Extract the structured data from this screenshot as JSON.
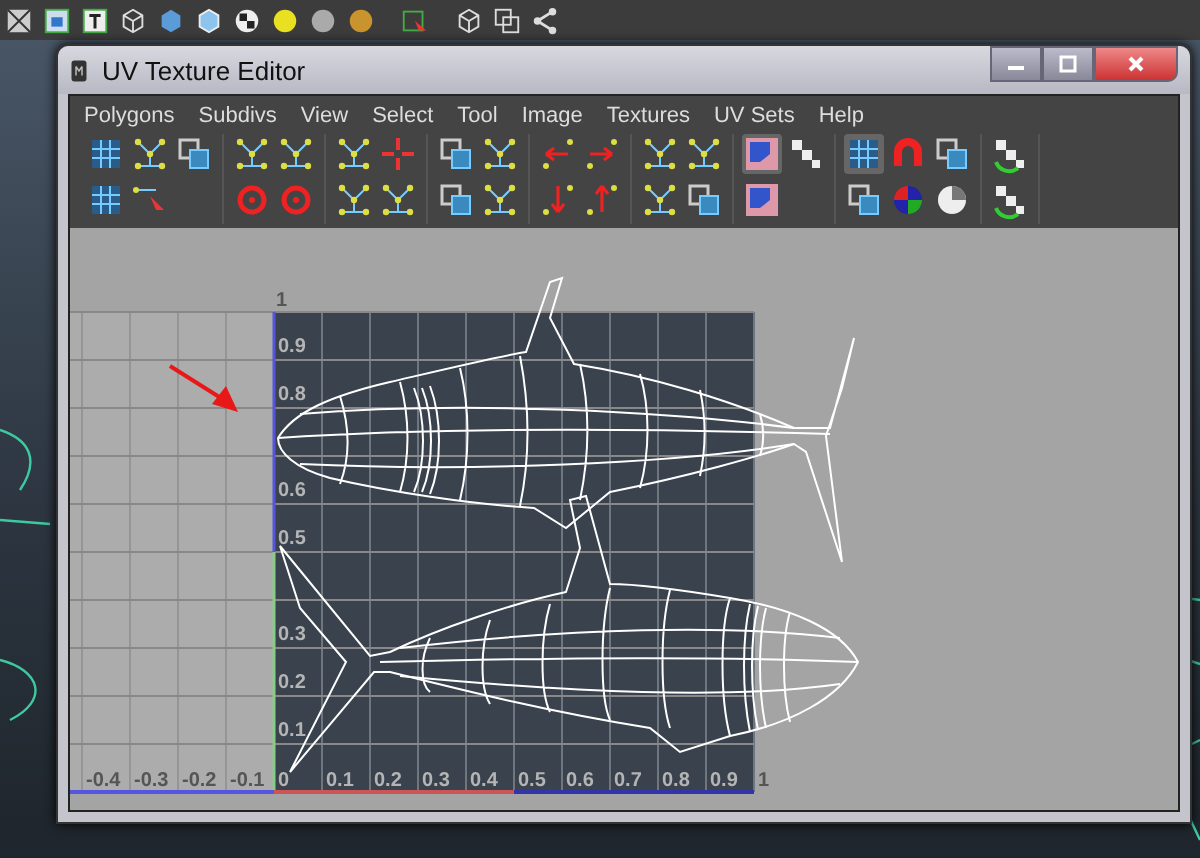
{
  "window": {
    "title": "UV Texture Editor"
  },
  "menu": [
    "Polygons",
    "Subdivs",
    "View",
    "Select",
    "Tool",
    "Image",
    "Textures",
    "UV Sets",
    "Help"
  ],
  "uv_grid": {
    "top_label": "1",
    "v_labels": [
      "0.9",
      "0.8",
      "0.6",
      "0.5",
      "0.3",
      "0.2",
      "0.1"
    ],
    "u_labels": [
      "-0.4",
      "-0.3",
      "-0.2",
      "-0.1",
      "0",
      "0.1",
      "0.2",
      "0.3",
      "0.4",
      "0.5",
      "0.6",
      "0.7",
      "0.8",
      "0.9",
      "1"
    ]
  }
}
